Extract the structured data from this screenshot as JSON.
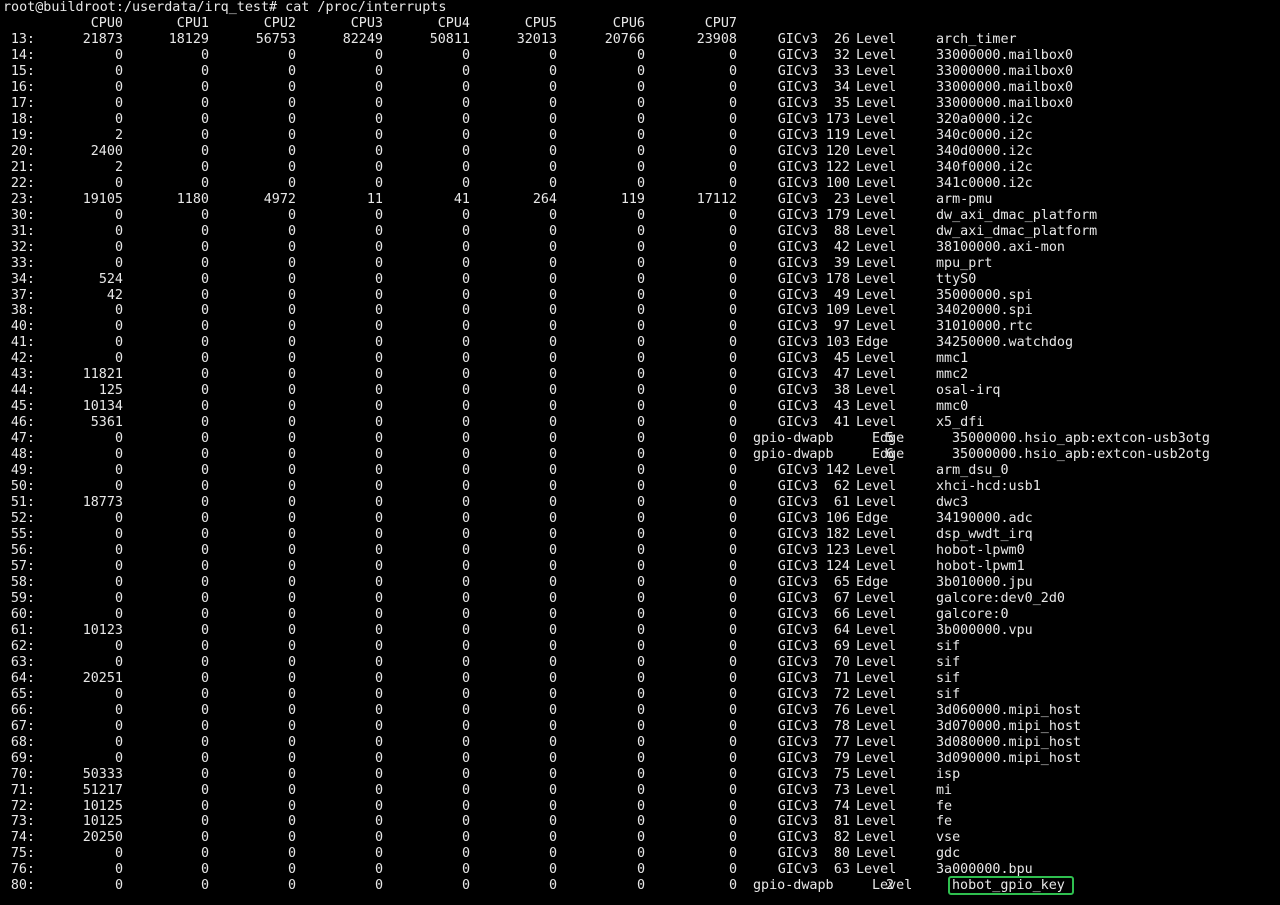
{
  "terminal": {
    "prompt": "root@buildroot:/userdata/irq_test#",
    "command": "cat /proc/interrupts",
    "cpu_headers": [
      "CPU0",
      "CPU1",
      "CPU2",
      "CPU3",
      "CPU4",
      "CPU5",
      "CPU6",
      "CPU7"
    ],
    "highlight_color": "#2fbf4f",
    "rows": [
      {
        "irq": "13:",
        "counts": [
          "21873",
          "18129",
          "56753",
          "82249",
          "50811",
          "32013",
          "20766",
          "23908"
        ],
        "chip": "GICv3",
        "hwirq": "26",
        "type": "Level",
        "device": "arch_timer"
      },
      {
        "irq": "14:",
        "counts": [
          "0",
          "0",
          "0",
          "0",
          "0",
          "0",
          "0",
          "0"
        ],
        "chip": "GICv3",
        "hwirq": "32",
        "type": "Level",
        "device": "33000000.mailbox0"
      },
      {
        "irq": "15:",
        "counts": [
          "0",
          "0",
          "0",
          "0",
          "0",
          "0",
          "0",
          "0"
        ],
        "chip": "GICv3",
        "hwirq": "33",
        "type": "Level",
        "device": "33000000.mailbox0"
      },
      {
        "irq": "16:",
        "counts": [
          "0",
          "0",
          "0",
          "0",
          "0",
          "0",
          "0",
          "0"
        ],
        "chip": "GICv3",
        "hwirq": "34",
        "type": "Level",
        "device": "33000000.mailbox0"
      },
      {
        "irq": "17:",
        "counts": [
          "0",
          "0",
          "0",
          "0",
          "0",
          "0",
          "0",
          "0"
        ],
        "chip": "GICv3",
        "hwirq": "35",
        "type": "Level",
        "device": "33000000.mailbox0"
      },
      {
        "irq": "18:",
        "counts": [
          "0",
          "0",
          "0",
          "0",
          "0",
          "0",
          "0",
          "0"
        ],
        "chip": "GICv3",
        "hwirq": "173",
        "type": "Level",
        "device": "320a0000.i2c"
      },
      {
        "irq": "19:",
        "counts": [
          "2",
          "0",
          "0",
          "0",
          "0",
          "0",
          "0",
          "0"
        ],
        "chip": "GICv3",
        "hwirq": "119",
        "type": "Level",
        "device": "340c0000.i2c"
      },
      {
        "irq": "20:",
        "counts": [
          "2400",
          "0",
          "0",
          "0",
          "0",
          "0",
          "0",
          "0"
        ],
        "chip": "GICv3",
        "hwirq": "120",
        "type": "Level",
        "device": "340d0000.i2c"
      },
      {
        "irq": "21:",
        "counts": [
          "2",
          "0",
          "0",
          "0",
          "0",
          "0",
          "0",
          "0"
        ],
        "chip": "GICv3",
        "hwirq": "122",
        "type": "Level",
        "device": "340f0000.i2c"
      },
      {
        "irq": "22:",
        "counts": [
          "0",
          "0",
          "0",
          "0",
          "0",
          "0",
          "0",
          "0"
        ],
        "chip": "GICv3",
        "hwirq": "100",
        "type": "Level",
        "device": "341c0000.i2c"
      },
      {
        "irq": "23:",
        "counts": [
          "19105",
          "1180",
          "4972",
          "11",
          "41",
          "264",
          "119",
          "17112"
        ],
        "chip": "GICv3",
        "hwirq": "23",
        "type": "Level",
        "device": "arm-pmu"
      },
      {
        "irq": "30:",
        "counts": [
          "0",
          "0",
          "0",
          "0",
          "0",
          "0",
          "0",
          "0"
        ],
        "chip": "GICv3",
        "hwirq": "179",
        "type": "Level",
        "device": "dw_axi_dmac_platform"
      },
      {
        "irq": "31:",
        "counts": [
          "0",
          "0",
          "0",
          "0",
          "0",
          "0",
          "0",
          "0"
        ],
        "chip": "GICv3",
        "hwirq": "88",
        "type": "Level",
        "device": "dw_axi_dmac_platform"
      },
      {
        "irq": "32:",
        "counts": [
          "0",
          "0",
          "0",
          "0",
          "0",
          "0",
          "0",
          "0"
        ],
        "chip": "GICv3",
        "hwirq": "42",
        "type": "Level",
        "device": "38100000.axi-mon"
      },
      {
        "irq": "33:",
        "counts": [
          "0",
          "0",
          "0",
          "0",
          "0",
          "0",
          "0",
          "0"
        ],
        "chip": "GICv3",
        "hwirq": "39",
        "type": "Level",
        "device": "mpu_prt"
      },
      {
        "irq": "34:",
        "counts": [
          "524",
          "0",
          "0",
          "0",
          "0",
          "0",
          "0",
          "0"
        ],
        "chip": "GICv3",
        "hwirq": "178",
        "type": "Level",
        "device": "ttyS0"
      },
      {
        "irq": "37:",
        "counts": [
          "42",
          "0",
          "0",
          "0",
          "0",
          "0",
          "0",
          "0"
        ],
        "chip": "GICv3",
        "hwirq": "49",
        "type": "Level",
        "device": "35000000.spi"
      },
      {
        "irq": "38:",
        "counts": [
          "0",
          "0",
          "0",
          "0",
          "0",
          "0",
          "0",
          "0"
        ],
        "chip": "GICv3",
        "hwirq": "109",
        "type": "Level",
        "device": "34020000.spi"
      },
      {
        "irq": "40:",
        "counts": [
          "0",
          "0",
          "0",
          "0",
          "0",
          "0",
          "0",
          "0"
        ],
        "chip": "GICv3",
        "hwirq": "97",
        "type": "Level",
        "device": "31010000.rtc"
      },
      {
        "irq": "41:",
        "counts": [
          "0",
          "0",
          "0",
          "0",
          "0",
          "0",
          "0",
          "0"
        ],
        "chip": "GICv3",
        "hwirq": "103",
        "type": "Edge",
        "device": "34250000.watchdog"
      },
      {
        "irq": "42:",
        "counts": [
          "0",
          "0",
          "0",
          "0",
          "0",
          "0",
          "0",
          "0"
        ],
        "chip": "GICv3",
        "hwirq": "45",
        "type": "Level",
        "device": "mmc1"
      },
      {
        "irq": "43:",
        "counts": [
          "11821",
          "0",
          "0",
          "0",
          "0",
          "0",
          "0",
          "0"
        ],
        "chip": "GICv3",
        "hwirq": "47",
        "type": "Level",
        "device": "mmc2"
      },
      {
        "irq": "44:",
        "counts": [
          "125",
          "0",
          "0",
          "0",
          "0",
          "0",
          "0",
          "0"
        ],
        "chip": "GICv3",
        "hwirq": "38",
        "type": "Level",
        "device": "osal-irq"
      },
      {
        "irq": "45:",
        "counts": [
          "10134",
          "0",
          "0",
          "0",
          "0",
          "0",
          "0",
          "0"
        ],
        "chip": "GICv3",
        "hwirq": "43",
        "type": "Level",
        "device": "mmc0"
      },
      {
        "irq": "46:",
        "counts": [
          "5361",
          "0",
          "0",
          "0",
          "0",
          "0",
          "0",
          "0"
        ],
        "chip": "GICv3",
        "hwirq": "41",
        "type": "Level",
        "device": "x5_dfi"
      },
      {
        "irq": "47:",
        "counts": [
          "0",
          "0",
          "0",
          "0",
          "0",
          "0",
          "0",
          "0"
        ],
        "chip": "gpio-dwapb",
        "hwirq": "5",
        "type": "Edge",
        "device": "35000000.hsio_apb:extcon-usb3otg"
      },
      {
        "irq": "48:",
        "counts": [
          "0",
          "0",
          "0",
          "0",
          "0",
          "0",
          "0",
          "0"
        ],
        "chip": "gpio-dwapb",
        "hwirq": "6",
        "type": "Edge",
        "device": "35000000.hsio_apb:extcon-usb2otg"
      },
      {
        "irq": "49:",
        "counts": [
          "0",
          "0",
          "0",
          "0",
          "0",
          "0",
          "0",
          "0"
        ],
        "chip": "GICv3",
        "hwirq": "142",
        "type": "Level",
        "device": "arm_dsu_0"
      },
      {
        "irq": "50:",
        "counts": [
          "0",
          "0",
          "0",
          "0",
          "0",
          "0",
          "0",
          "0"
        ],
        "chip": "GICv3",
        "hwirq": "62",
        "type": "Level",
        "device": "xhci-hcd:usb1"
      },
      {
        "irq": "51:",
        "counts": [
          "18773",
          "0",
          "0",
          "0",
          "0",
          "0",
          "0",
          "0"
        ],
        "chip": "GICv3",
        "hwirq": "61",
        "type": "Level",
        "device": "dwc3"
      },
      {
        "irq": "52:",
        "counts": [
          "0",
          "0",
          "0",
          "0",
          "0",
          "0",
          "0",
          "0"
        ],
        "chip": "GICv3",
        "hwirq": "106",
        "type": "Edge",
        "device": "34190000.adc"
      },
      {
        "irq": "55:",
        "counts": [
          "0",
          "0",
          "0",
          "0",
          "0",
          "0",
          "0",
          "0"
        ],
        "chip": "GICv3",
        "hwirq": "182",
        "type": "Level",
        "device": "dsp_wwdt_irq"
      },
      {
        "irq": "56:",
        "counts": [
          "0",
          "0",
          "0",
          "0",
          "0",
          "0",
          "0",
          "0"
        ],
        "chip": "GICv3",
        "hwirq": "123",
        "type": "Level",
        "device": "hobot-lpwm0"
      },
      {
        "irq": "57:",
        "counts": [
          "0",
          "0",
          "0",
          "0",
          "0",
          "0",
          "0",
          "0"
        ],
        "chip": "GICv3",
        "hwirq": "124",
        "type": "Level",
        "device": "hobot-lpwm1"
      },
      {
        "irq": "58:",
        "counts": [
          "0",
          "0",
          "0",
          "0",
          "0",
          "0",
          "0",
          "0"
        ],
        "chip": "GICv3",
        "hwirq": "65",
        "type": "Edge",
        "device": "3b010000.jpu"
      },
      {
        "irq": "59:",
        "counts": [
          "0",
          "0",
          "0",
          "0",
          "0",
          "0",
          "0",
          "0"
        ],
        "chip": "GICv3",
        "hwirq": "67",
        "type": "Level",
        "device": "galcore:dev0_2d0"
      },
      {
        "irq": "60:",
        "counts": [
          "0",
          "0",
          "0",
          "0",
          "0",
          "0",
          "0",
          "0"
        ],
        "chip": "GICv3",
        "hwirq": "66",
        "type": "Level",
        "device": "galcore:0"
      },
      {
        "irq": "61:",
        "counts": [
          "10123",
          "0",
          "0",
          "0",
          "0",
          "0",
          "0",
          "0"
        ],
        "chip": "GICv3",
        "hwirq": "64",
        "type": "Level",
        "device": "3b000000.vpu"
      },
      {
        "irq": "62:",
        "counts": [
          "0",
          "0",
          "0",
          "0",
          "0",
          "0",
          "0",
          "0"
        ],
        "chip": "GICv3",
        "hwirq": "69",
        "type": "Level",
        "device": "sif"
      },
      {
        "irq": "63:",
        "counts": [
          "0",
          "0",
          "0",
          "0",
          "0",
          "0",
          "0",
          "0"
        ],
        "chip": "GICv3",
        "hwirq": "70",
        "type": "Level",
        "device": "sif"
      },
      {
        "irq": "64:",
        "counts": [
          "20251",
          "0",
          "0",
          "0",
          "0",
          "0",
          "0",
          "0"
        ],
        "chip": "GICv3",
        "hwirq": "71",
        "type": "Level",
        "device": "sif"
      },
      {
        "irq": "65:",
        "counts": [
          "0",
          "0",
          "0",
          "0",
          "0",
          "0",
          "0",
          "0"
        ],
        "chip": "GICv3",
        "hwirq": "72",
        "type": "Level",
        "device": "sif"
      },
      {
        "irq": "66:",
        "counts": [
          "0",
          "0",
          "0",
          "0",
          "0",
          "0",
          "0",
          "0"
        ],
        "chip": "GICv3",
        "hwirq": "76",
        "type": "Level",
        "device": "3d060000.mipi_host"
      },
      {
        "irq": "67:",
        "counts": [
          "0",
          "0",
          "0",
          "0",
          "0",
          "0",
          "0",
          "0"
        ],
        "chip": "GICv3",
        "hwirq": "78",
        "type": "Level",
        "device": "3d070000.mipi_host"
      },
      {
        "irq": "68:",
        "counts": [
          "0",
          "0",
          "0",
          "0",
          "0",
          "0",
          "0",
          "0"
        ],
        "chip": "GICv3",
        "hwirq": "77",
        "type": "Level",
        "device": "3d080000.mipi_host"
      },
      {
        "irq": "69:",
        "counts": [
          "0",
          "0",
          "0",
          "0",
          "0",
          "0",
          "0",
          "0"
        ],
        "chip": "GICv3",
        "hwirq": "79",
        "type": "Level",
        "device": "3d090000.mipi_host"
      },
      {
        "irq": "70:",
        "counts": [
          "50333",
          "0",
          "0",
          "0",
          "0",
          "0",
          "0",
          "0"
        ],
        "chip": "GICv3",
        "hwirq": "75",
        "type": "Level",
        "device": "isp"
      },
      {
        "irq": "71:",
        "counts": [
          "51217",
          "0",
          "0",
          "0",
          "0",
          "0",
          "0",
          "0"
        ],
        "chip": "GICv3",
        "hwirq": "73",
        "type": "Level",
        "device": "mi"
      },
      {
        "irq": "72:",
        "counts": [
          "10125",
          "0",
          "0",
          "0",
          "0",
          "0",
          "0",
          "0"
        ],
        "chip": "GICv3",
        "hwirq": "74",
        "type": "Level",
        "device": "fe"
      },
      {
        "irq": "73:",
        "counts": [
          "10125",
          "0",
          "0",
          "0",
          "0",
          "0",
          "0",
          "0"
        ],
        "chip": "GICv3",
        "hwirq": "81",
        "type": "Level",
        "device": "fe"
      },
      {
        "irq": "74:",
        "counts": [
          "20250",
          "0",
          "0",
          "0",
          "0",
          "0",
          "0",
          "0"
        ],
        "chip": "GICv3",
        "hwirq": "82",
        "type": "Level",
        "device": "vse"
      },
      {
        "irq": "75:",
        "counts": [
          "0",
          "0",
          "0",
          "0",
          "0",
          "0",
          "0",
          "0"
        ],
        "chip": "GICv3",
        "hwirq": "80",
        "type": "Level",
        "device": "gdc"
      },
      {
        "irq": "76:",
        "counts": [
          "0",
          "0",
          "0",
          "0",
          "0",
          "0",
          "0",
          "0"
        ],
        "chip": "GICv3",
        "hwirq": "63",
        "type": "Level",
        "device": "3a000000.bpu"
      },
      {
        "irq": "80:",
        "counts": [
          "0",
          "0",
          "0",
          "0",
          "0",
          "0",
          "0",
          "0"
        ],
        "chip": "gpio-dwapb",
        "hwirq": "2",
        "type": "Level",
        "device": "hobot_gpio_key",
        "highlighted": true
      }
    ]
  }
}
